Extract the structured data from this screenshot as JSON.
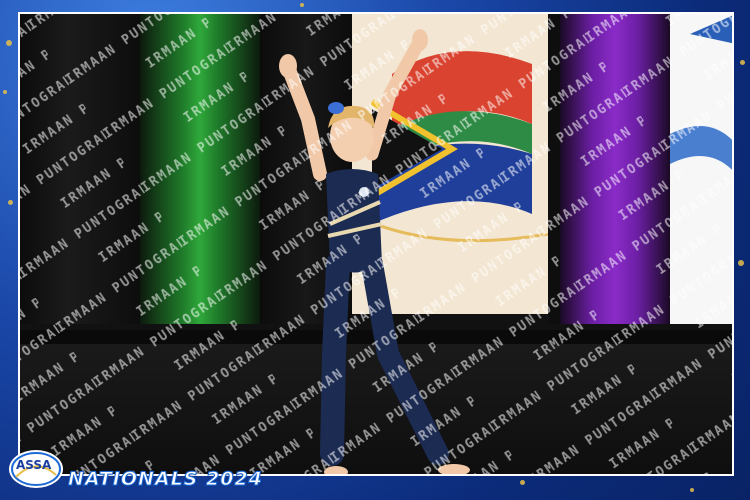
{
  "event": {
    "title": "NATIONALS 2024",
    "logo_text": "ASSA"
  },
  "watermark": {
    "text": "IRMAAN PUNTOGRAPHY"
  },
  "colors": {
    "frame_blue": "#1a47a8",
    "gold": "#e6c04a",
    "leotard": "#1c2b52",
    "curtain_green": "#2fa83a",
    "curtain_purple": "#8a2bc8"
  }
}
